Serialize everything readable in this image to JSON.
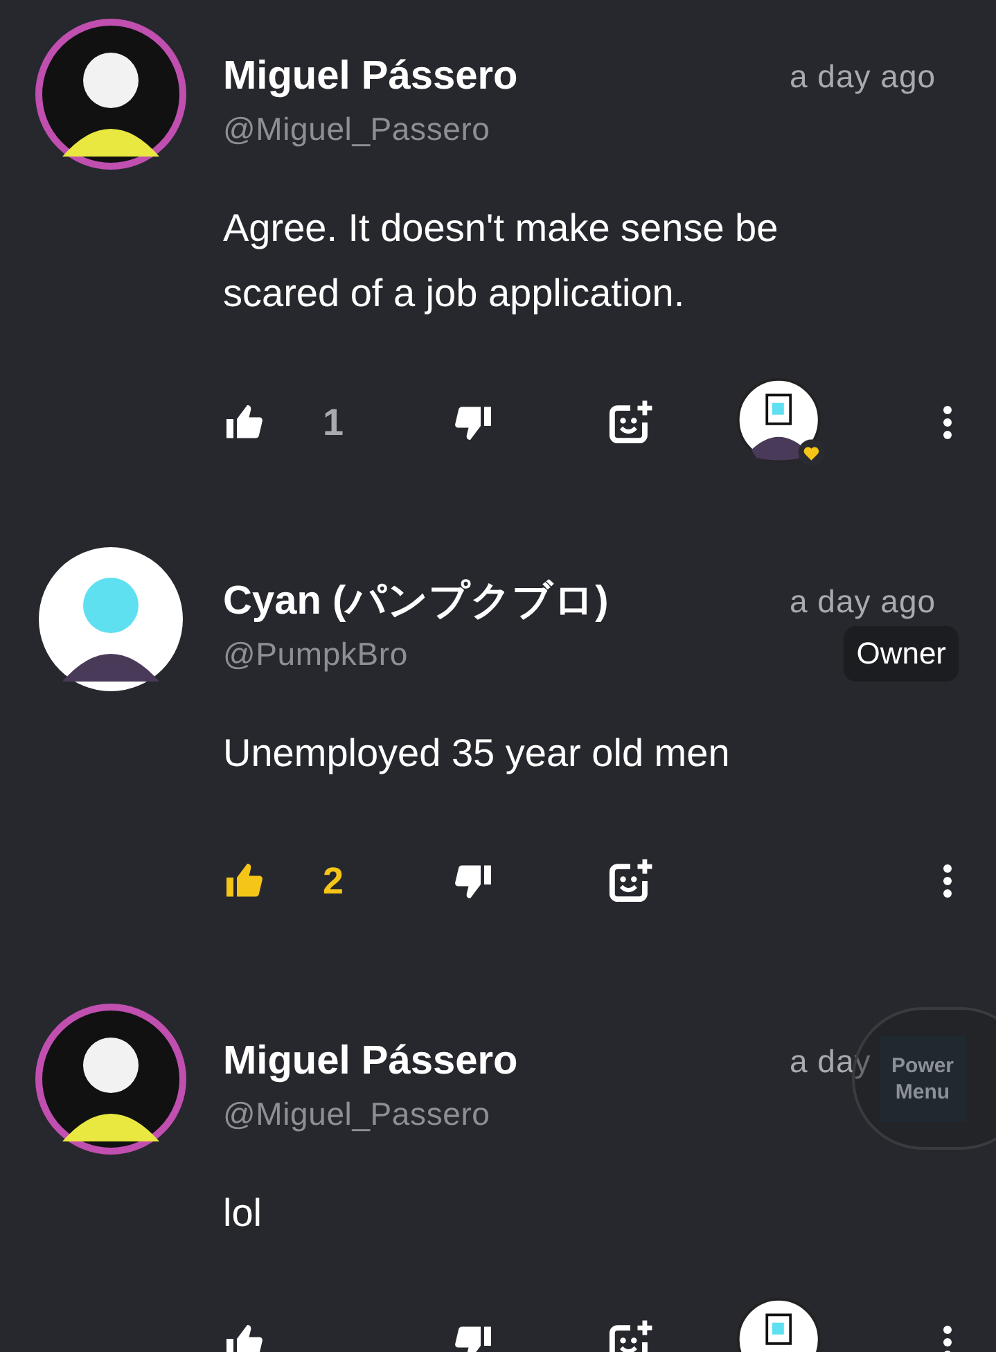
{
  "comments": [
    {
      "name": "Miguel Pássero",
      "handle": "@Miguel_Passero",
      "time": "a day ago",
      "body": "Agree. It doesn't make sense be scared of a job application.",
      "likes": "1",
      "liked": false,
      "hearted": true
    },
    {
      "name": "Cyan (パンプクブロ)",
      "handle": "@PumpkBro",
      "time": "a day ago",
      "badge": "Owner",
      "body": "Unemployed 35 year old men",
      "likes": "2",
      "liked": true,
      "hearted": false
    },
    {
      "name": "Miguel Pássero",
      "handle": "@Miguel_Passero",
      "time": "a day",
      "body": "lol",
      "liked": false,
      "hearted": true
    }
  ],
  "power_menu": {
    "label": "Power Menu"
  }
}
